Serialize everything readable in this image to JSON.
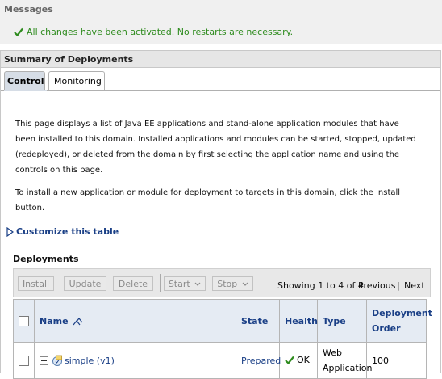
{
  "messages": {
    "title": "Messages",
    "success_text": "All changes have been activated. No restarts are necessary."
  },
  "summary": {
    "title": "Summary of Deployments",
    "tabs": [
      {
        "label": "Control",
        "active": true
      },
      {
        "label": "Monitoring",
        "active": false
      }
    ]
  },
  "description": {
    "paragraph1": "This page displays a list of Java EE applications and stand-alone application modules that have been installed to this domain. Installed applications and modules can be started, stopped, updated (redeployed), or deleted from the domain by first selecting the application name and using the controls on this page.",
    "paragraph2": "To install a new application or module for deployment to targets in this domain, click the Install button."
  },
  "customize_link": "Customize this table",
  "deployments": {
    "title": "Deployments",
    "toolbar": {
      "install": "Install",
      "update": "Update",
      "delete": "Delete",
      "start": "Start",
      "stop": "Stop",
      "showing": "Showing 1 to 4 of 4",
      "previous": "Previous",
      "pager_sep": "|",
      "next": "Next"
    },
    "columns": {
      "name": "Name",
      "state": "State",
      "health": "Health",
      "type": "Type",
      "order": "Deployment Order"
    },
    "rows": [
      {
        "name": "simple (v1)",
        "state": "Prepared",
        "health": "OK",
        "type": "Web Application",
        "order": "100"
      }
    ]
  },
  "colors": {
    "success": "#2e8b1e",
    "link": "#1a3f86",
    "header_bg": "#e5ebf3"
  }
}
